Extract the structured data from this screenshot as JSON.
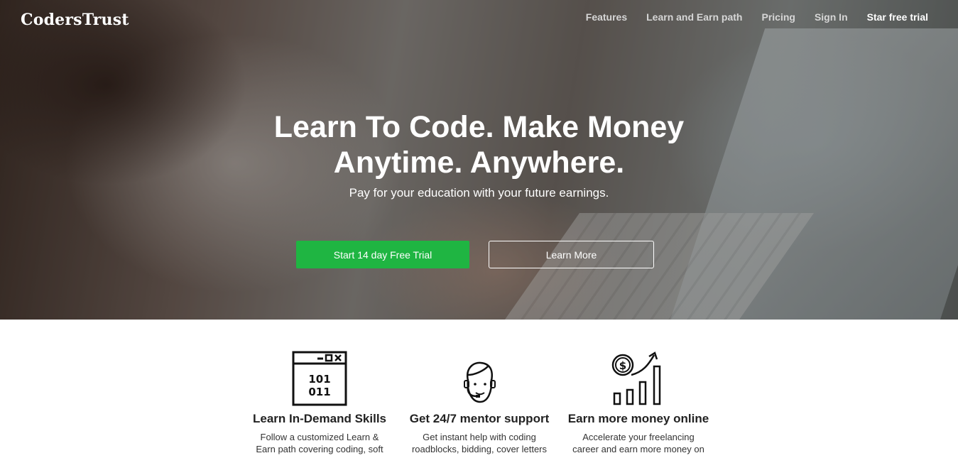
{
  "header": {
    "logo": "CodersTrust",
    "nav": [
      "Features",
      "Learn and Earn path",
      "Pricing",
      "Sign In",
      "Star free trial"
    ]
  },
  "hero": {
    "headline_line1": "Learn To Code. Make Money",
    "headline_line2": "Anytime. Anywhere.",
    "subheadline": "Pay for your education with your future earnings.",
    "primary_cta": "Start 14 day Free Trial",
    "secondary_cta": "Learn More"
  },
  "features": [
    {
      "icon": "binary-code-window-icon",
      "icon_text": [
        "101",
        "011"
      ],
      "title": "Learn In-Demand Skills",
      "desc_line1": "Follow a customized Learn &",
      "desc_line2": "Earn path covering coding, soft"
    },
    {
      "icon": "mentor-headset-icon",
      "title": "Get 24/7 mentor support",
      "desc_line1": "Get instant help with coding",
      "desc_line2": "roadblocks, bidding, cover letters"
    },
    {
      "icon": "money-growth-chart-icon",
      "icon_text": [
        "$"
      ],
      "title": "Earn more money online",
      "desc_line1": "Accelerate your freelancing",
      "desc_line2": "career and earn more money on"
    }
  ],
  "colors": {
    "accent_green": "#1fb542",
    "nav_text": "#d6d6d6",
    "white": "#ffffff"
  }
}
